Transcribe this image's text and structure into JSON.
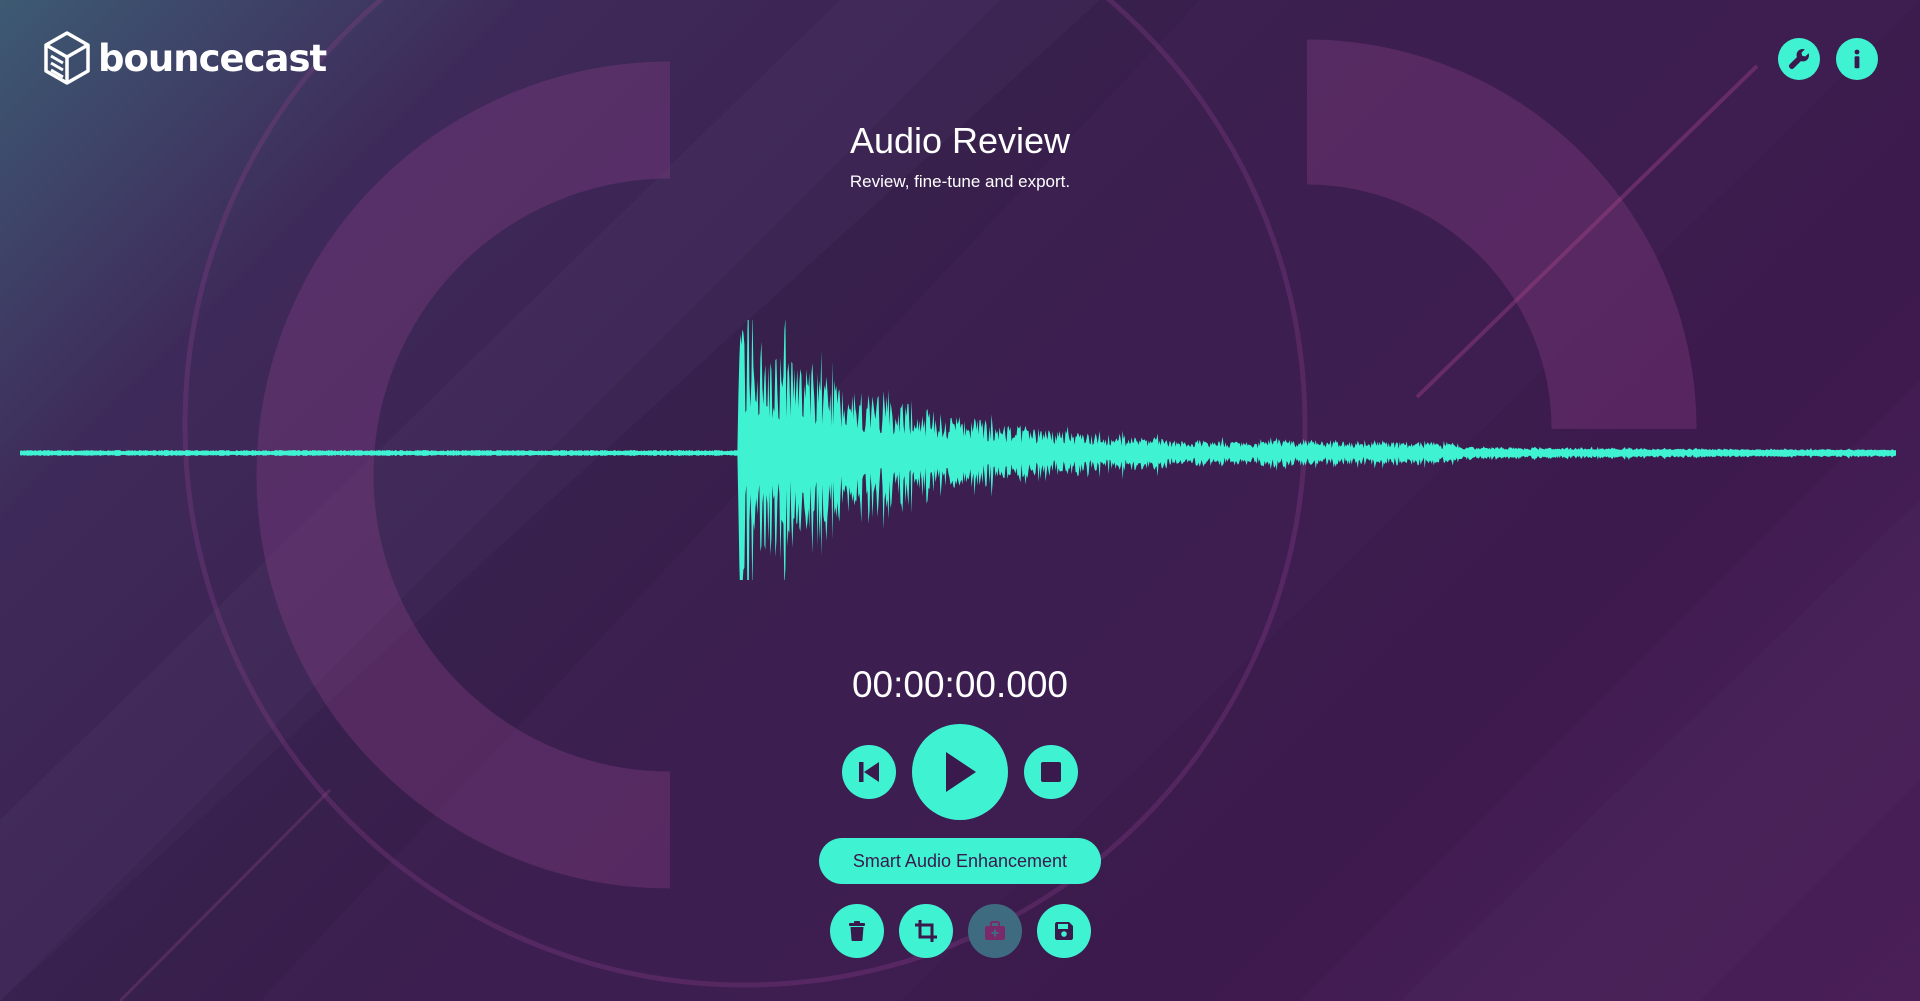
{
  "app": {
    "brand": "bouncecast"
  },
  "header": {
    "icons": [
      "wrench-icon",
      "info-icon"
    ]
  },
  "main": {
    "title": "Audio Review",
    "subtitle": "Review, fine-tune and export."
  },
  "player": {
    "time": "00:00:00.000",
    "icons": [
      "skip-back-icon",
      "play-icon",
      "stop-icon"
    ]
  },
  "actions": {
    "enhance_label": "Smart Audio Enhancement",
    "tools": [
      {
        "icon": "trash-icon",
        "enabled": true
      },
      {
        "icon": "crop-icon",
        "enabled": true
      },
      {
        "icon": "toolbox-icon",
        "enabled": false
      },
      {
        "icon": "save-icon",
        "enabled": true
      }
    ]
  },
  "colors": {
    "accent": "#3ff3d2",
    "button_text": "#3a1a4c",
    "disabled": "#3f6b80",
    "bg_dark": "#3b1f4f",
    "bg_teal": "#3d5a73"
  }
}
